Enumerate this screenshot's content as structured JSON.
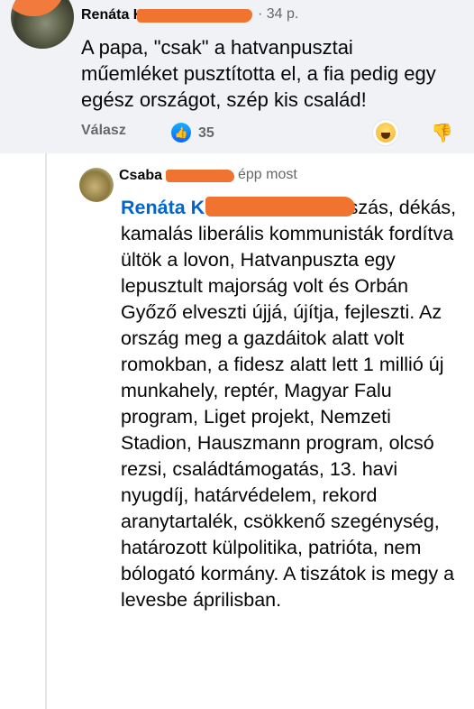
{
  "comment": {
    "author": "Renáta K",
    "time": "· 34 p.",
    "text": "A papa, \"csak\" a hatvanpusztai műemléket pusztította el, a fia pedig egy egész országot, szép kis család!",
    "reply_label": "Válasz",
    "like_count": "35",
    "icons": [
      "like-icon",
      "haha-icon",
      "dislike-icon"
    ]
  },
  "reply": {
    "author": "Csaba",
    "time": "épp most",
    "mention": "Renáta K",
    "text": "Ti tiszás, dékás, kamalás liberális kommunisták fordítva ültök a lovon, Hatvanpuszta egy lepusztult majorság volt és Orbán Győző elveszti újjá, újítja, fejleszti. Az ország meg a gazdáitok alatt volt romokban, a fidesz alatt lett 1 millió új munkahely, reptér, Magyar Falu program, Liget projekt, Nemzeti Stadion, Hauszmann program, olcsó rezsi, családtámogatás, 13. havi nyugdíj, határvédelem, rekord aranytartalék, csökkenő szegénység, határozott külpolitika, patrióta, nem bólogató kormány. A tiszátok is megy a levesbe áprilisban."
  },
  "colors": {
    "redaction": "#f0732f",
    "mention": "#0064d1",
    "muted": "#65676b",
    "bubble_bg": "#f0f2f5"
  }
}
